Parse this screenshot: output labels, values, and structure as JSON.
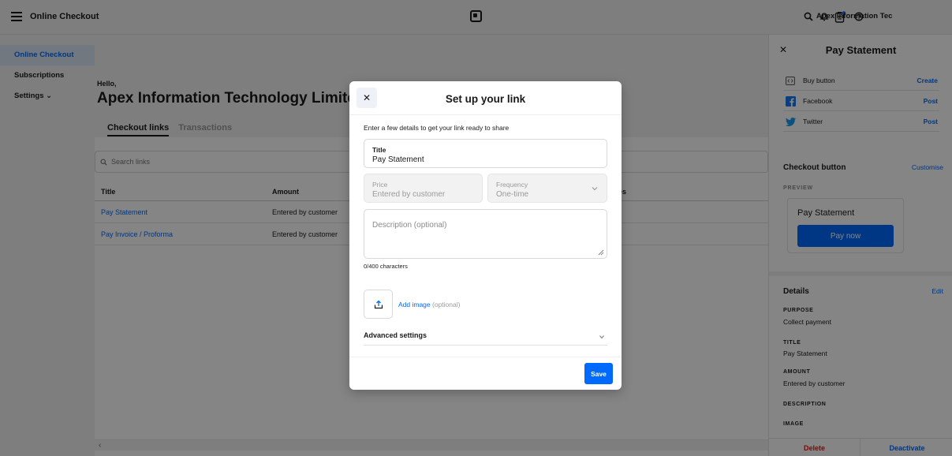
{
  "topbar": {
    "app_title": "Online Checkout",
    "account_name": "Apex Information Tec",
    "icons": [
      "menu-icon",
      "square-logo-icon",
      "search-icon",
      "bell-icon",
      "clipboard-icon",
      "help-icon"
    ],
    "notification_dot_color": "#006aff"
  },
  "sidebar": {
    "items": [
      {
        "label": "Online Checkout",
        "active": true
      },
      {
        "label": "Subscriptions"
      },
      {
        "label": "Settings ⌄"
      }
    ]
  },
  "main": {
    "greeting": "Hello,",
    "merchant_name": "Apex Information Technology Limited",
    "tabs": [
      {
        "label": "Checkout links",
        "active": true
      },
      {
        "label": "Transactions"
      }
    ],
    "search_placeholder": "Search links",
    "table": {
      "headers": [
        "Title",
        "Amount",
        "es"
      ],
      "rows": [
        {
          "title": "Pay Statement",
          "amount": "Entered by customer"
        },
        {
          "title": "Pay Invoice / Proforma",
          "amount": "Entered by customer"
        }
      ]
    },
    "scroll_arrow": "‹"
  },
  "modal": {
    "title": "Set up your link",
    "intro": "Enter a few details to get your link ready to share",
    "title_field": {
      "label": "Title",
      "value": "Pay Statement"
    },
    "price_field": {
      "label": "Price",
      "value": "Entered by customer"
    },
    "frequency_field": {
      "label": "Frequency",
      "value": "One-time"
    },
    "description_placeholder": "Description (optional)",
    "char_counter": "0/400 characters",
    "add_image_label": "Add image",
    "add_image_optional": "(optional)",
    "advanced_label": "Advanced settings",
    "save_label": "Save"
  },
  "right_panel": {
    "title": "Pay Statement",
    "share": [
      {
        "label": "Buy button",
        "action": "Create",
        "icon": "code-icon"
      },
      {
        "label": "Facebook",
        "action": "Post",
        "icon": "facebook-icon"
      },
      {
        "label": "Twitter",
        "action": "Post",
        "icon": "twitter-icon"
      }
    ],
    "checkout_button": {
      "title": "Checkout button",
      "customise_label": "Customise",
      "preview_label": "PREVIEW",
      "preview_title": "Pay Statement",
      "pay_button_label": "Pay now"
    },
    "details": {
      "title": "Details",
      "edit_label": "Edit",
      "purpose_label": "PURPOSE",
      "purpose_value": "Collect payment",
      "title_label": "TITLE",
      "title_value": "Pay Statement",
      "amount_label": "AMOUNT",
      "amount_value": "Entered by customer",
      "description_label": "DESCRIPTION",
      "image_label": "IMAGE"
    },
    "footer": {
      "delete_label": "Delete",
      "deactivate_label": "Deactivate"
    }
  },
  "colors": {
    "accent": "#006aff",
    "danger": "#d91e18",
    "facebook": "#1877f2",
    "twitter": "#1d9bf0"
  }
}
